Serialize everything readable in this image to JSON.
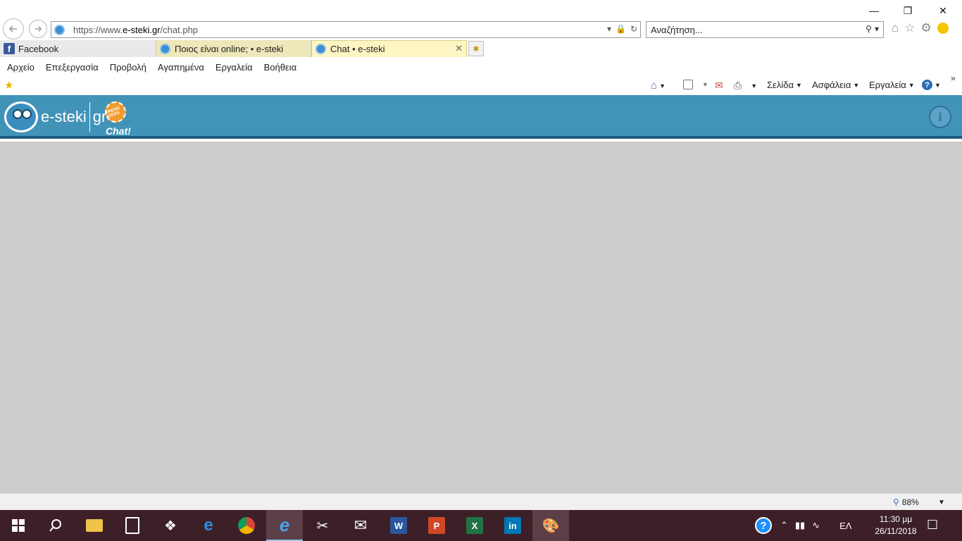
{
  "browser": {
    "address": {
      "scheme": "https://www.",
      "domain": "e-steki.gr",
      "path": "/chat.php"
    },
    "search": {
      "placeholder": "Αναζήτηση..."
    },
    "tabs": [
      {
        "label": "Facebook"
      },
      {
        "label": "Ποιος είναι online; • e-steki"
      },
      {
        "label": "Chat • e-steki"
      }
    ],
    "menu": [
      "Αρχείο",
      "Επεξεργασία",
      "Προβολή",
      "Αγαπημένα",
      "Εργαλεία",
      "Βοήθεια"
    ],
    "commands": {
      "page": "Σελίδα",
      "safety": "Ασφάλεια",
      "tools": "Εργαλεία"
    },
    "zoom": "88%"
  },
  "site": {
    "logo_text": "e-steki",
    "logo_gr": "gr",
    "logo_chat": "Chat!",
    "badge_text": "FRESH IDEAS"
  },
  "taskbar": {
    "language": "ΕΛ",
    "time": "11:30 μμ",
    "date": "26/11/2018"
  },
  "colors": {
    "header": "#4293b8",
    "content": "#cccccc",
    "taskbar": "#3c1f27"
  }
}
